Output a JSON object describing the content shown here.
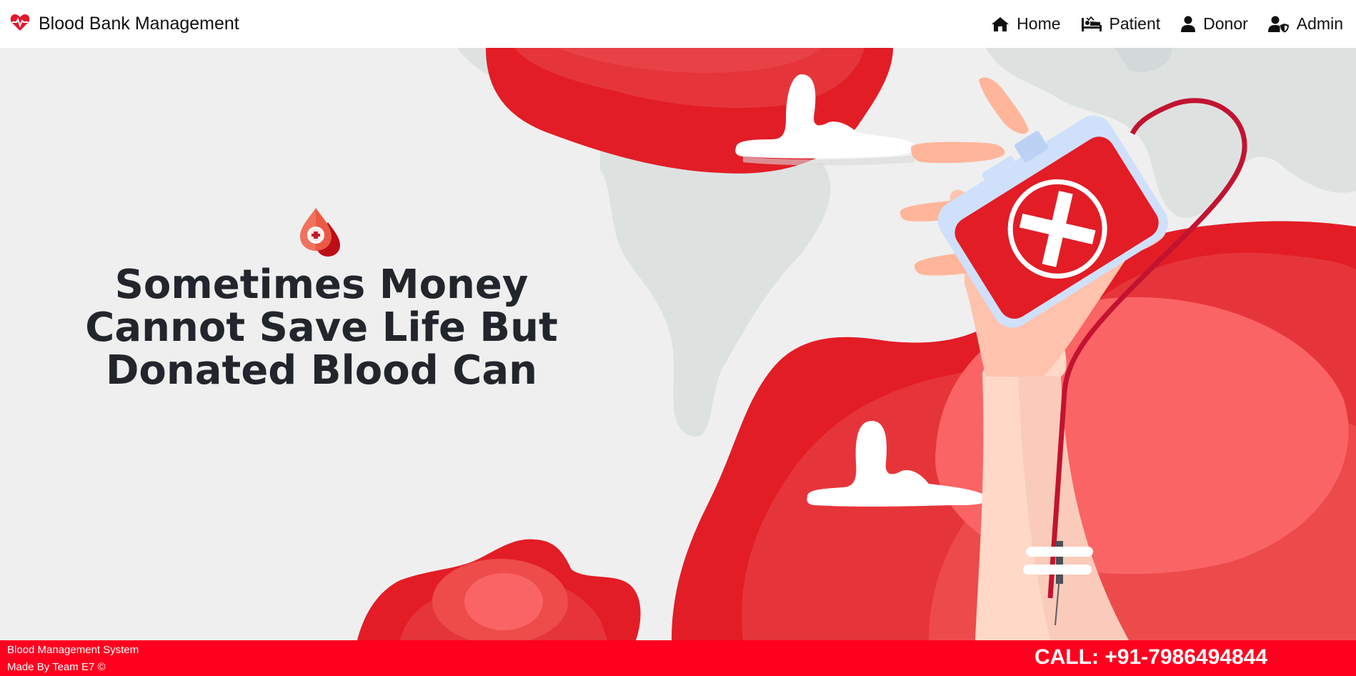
{
  "navbar": {
    "brand_title": "Blood Bank Management",
    "brand_icon": "heart-pulse-icon",
    "links": [
      {
        "label": "Home",
        "icon": "home-icon"
      },
      {
        "label": "Patient",
        "icon": "patient-bed-icon"
      },
      {
        "label": "Donor",
        "icon": "user-icon"
      },
      {
        "label": "Admin",
        "icon": "user-shield-icon"
      }
    ]
  },
  "hero": {
    "headline": "Sometimes Money Cannot Save Life But Donated Blood Can",
    "logo_icon": "blood-drop-icon",
    "illustration_icon": "blood-bag-hand-illustration"
  },
  "footer": {
    "line1": "Blood Management System",
    "line2": "Made By Team E7 ©",
    "call": "CALL: +91-7986494844"
  },
  "colors": {
    "brand_red": "#e3162b",
    "footer_red": "#ff001f",
    "background": "#efefef",
    "headline": "#22262c"
  }
}
